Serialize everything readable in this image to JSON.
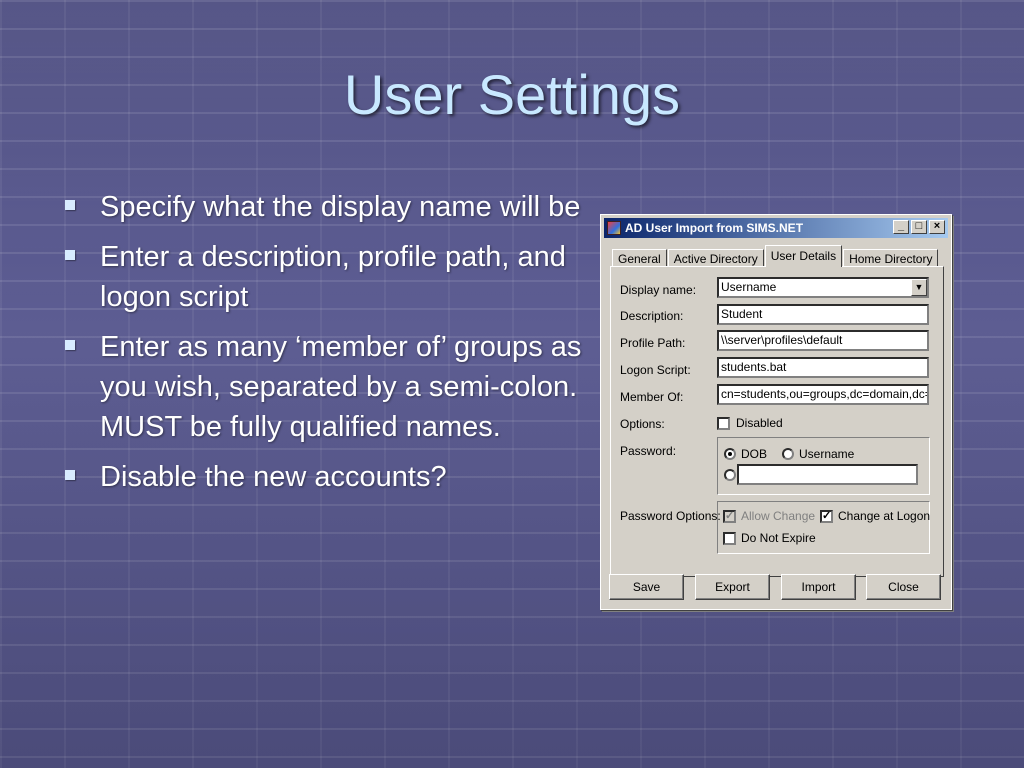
{
  "slide": {
    "title": "User Settings",
    "bullets": [
      "Specify what the display name will be",
      "Enter a description, profile path, and logon script",
      "Enter as many ‘member of’ groups as you wish, separated by a semi-colon. MUST be fully qualified names.",
      "Disable the new accounts?"
    ]
  },
  "dialog": {
    "title": "AD User Import from SIMS.NET",
    "window_buttons": {
      "minimize": "_",
      "maximize": "□",
      "close": "×"
    },
    "tabs": [
      "General",
      "Active Directory",
      "User Details",
      "Home Directory"
    ],
    "active_tab": "User Details",
    "fields": {
      "display_name_label": "Display name:",
      "display_name_value": "Username",
      "description_label": "Description:",
      "description_value": "Student",
      "profile_path_label": "Profile Path:",
      "profile_path_value": "\\\\server\\profiles\\default",
      "logon_script_label": "Logon Script:",
      "logon_script_value": "students.bat",
      "member_of_label": "Member Of:",
      "member_of_value": "cn=students,ou=groups,dc=domain,dc=lc"
    },
    "options": {
      "label": "Options:",
      "disabled_label": "Disabled",
      "disabled_checked": false
    },
    "password": {
      "label": "Password:",
      "dob_label": "DOB",
      "username_label": "Username",
      "selected": "DOB",
      "custom_value": ""
    },
    "password_options": {
      "label": "Password Options:",
      "allow_change_label": "Allow Change",
      "allow_change_checked": true,
      "allow_change_enabled": false,
      "change_at_logon_label": "Change at Logon",
      "change_at_logon_checked": true,
      "do_not_expire_label": "Do Not Expire",
      "do_not_expire_checked": false
    },
    "buttons": {
      "save": "Save",
      "export": "Export",
      "import": "Import",
      "close": "Close"
    }
  },
  "colors": {
    "title_text": "#c8e8ff",
    "titlebar_start": "#0a246a",
    "titlebar_end": "#a6caf0",
    "dialog_face": "#d4d0c8"
  }
}
